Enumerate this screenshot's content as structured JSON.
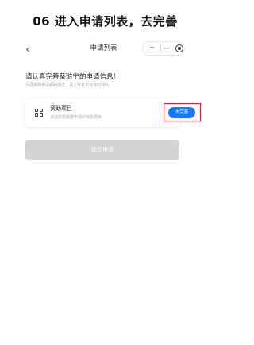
{
  "step_title": "06 进入申请列表，去完善",
  "navbar": {
    "back_glyph": "‹",
    "title": "申请列表",
    "capsule": {
      "more_glyph": "·•·",
      "minimize_glyph": "—",
      "close_icon": "target-icon"
    }
  },
  "prompt": {
    "title": "请认真完善蔡琏宁的申请信息!",
    "subtitle": "为便资助申请顺利通过，请上传真实有效的材料。"
  },
  "card": {
    "icon": "grid-icon",
    "title": "资助项目",
    "subtitle": "请选择您需要申请的资助项目",
    "action_label": "去完善"
  },
  "submit_label": "提交申请",
  "colors": {
    "accent": "#1677ff",
    "highlight": "#e0192c",
    "disabled": "#d4d4d4"
  }
}
